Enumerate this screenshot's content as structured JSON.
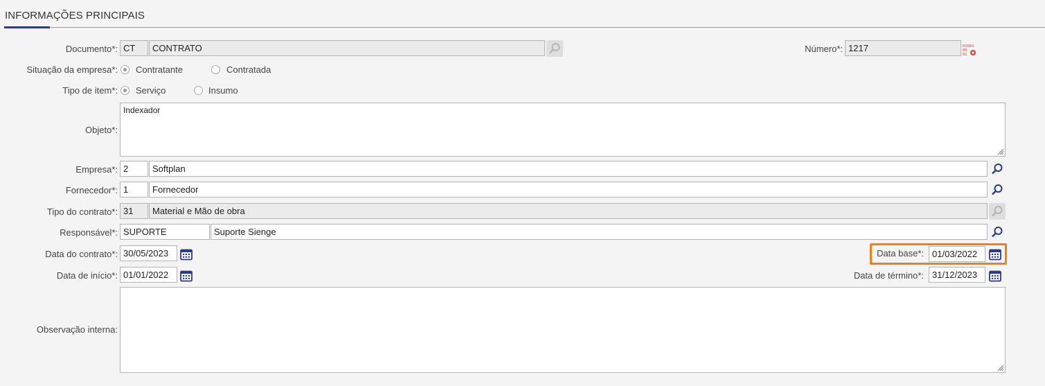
{
  "section": {
    "title": "INFORMAÇÕES PRINCIPAIS"
  },
  "documento": {
    "label": "Documento*:",
    "code": "CT",
    "name": "CONTRATO"
  },
  "numero": {
    "label": "Número*:",
    "value": "1217"
  },
  "situacao": {
    "label": "Situação da empresa*:",
    "options": [
      "Contratante",
      "Contratada"
    ],
    "selected": "Contratante"
  },
  "tipo_item": {
    "label": "Tipo de item*:",
    "options": [
      "Serviço",
      "Insumo"
    ],
    "selected": "Serviço"
  },
  "objeto": {
    "label": "Objeto*:",
    "value": "Indexador"
  },
  "empresa": {
    "label": "Empresa*:",
    "code": "2",
    "name": "Softplan"
  },
  "fornecedor": {
    "label": "Fornecedor*:",
    "code": "1",
    "name": "Fornecedor"
  },
  "tipo_contrato": {
    "label": "Tipo do contrato*:",
    "code": "31",
    "name": "Material e Mão de obra"
  },
  "responsavel": {
    "label": "Responsável*:",
    "code": "SUPORTE",
    "name": "Suporte Sienge"
  },
  "data_contrato": {
    "label": "Data do contrato*:",
    "value": "30/05/2023"
  },
  "data_base": {
    "label": "Data base*:",
    "value": "01/03/2022"
  },
  "data_inicio": {
    "label": "Data de início*:",
    "value": "01/01/2022"
  },
  "data_termino": {
    "label": "Data de término*:",
    "value": "31/12/2023"
  },
  "observacao": {
    "label": "Observação interna:",
    "value": ""
  },
  "colors": {
    "accent": "#2d3a8c",
    "highlight": "#f07f1e",
    "icon": "#2d3a8c"
  },
  "icons": [
    "search-icon",
    "calendar-icon",
    "number-generator-icon",
    "resize-grip-icon"
  ]
}
